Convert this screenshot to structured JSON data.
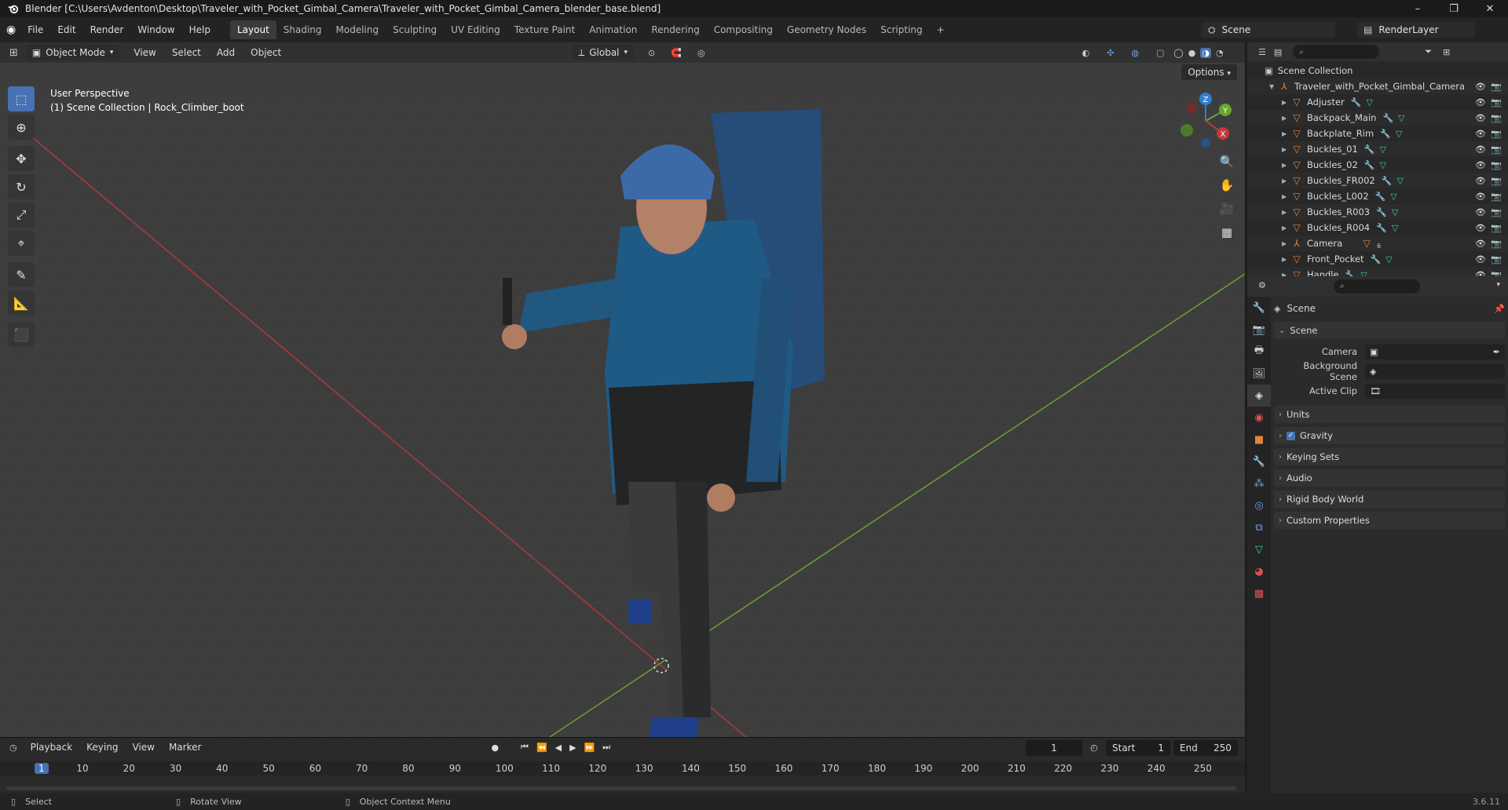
{
  "window": {
    "title": "Blender [C:\\Users\\Avdenton\\Desktop\\Traveler_with_Pocket_Gimbal_Camera\\Traveler_with_Pocket_Gimbal_Camera_blender_base.blend]",
    "controls": [
      "–",
      "❐",
      "✕"
    ]
  },
  "menu": [
    "File",
    "Edit",
    "Render",
    "Window",
    "Help"
  ],
  "workspaces": [
    "Layout",
    "Shading",
    "Modeling",
    "Sculpting",
    "UV Editing",
    "Texture Paint",
    "Animation",
    "Rendering",
    "Compositing",
    "Geometry Nodes",
    "Scripting",
    "+"
  ],
  "scene_name": "Scene",
  "view_layer": "RenderLayer",
  "viewport": {
    "mode": "Object Mode",
    "menus": [
      "View",
      "Select",
      "Add",
      "Object"
    ],
    "orientation": "Global",
    "options_label": "Options",
    "info_line1": "User Perspective",
    "info_line2": "(1) Scene Collection | Rock_Climber_boot",
    "axes": {
      "x": "X",
      "y": "Y",
      "z": "Z"
    }
  },
  "timeline": {
    "menus": [
      "Playback",
      "Keying",
      "View",
      "Marker"
    ],
    "current_frame": "1",
    "start_label": "Start",
    "start": "1",
    "end_label": "End",
    "end": "250",
    "ticks": [
      "1",
      "10",
      "20",
      "30",
      "40",
      "50",
      "60",
      "70",
      "80",
      "90",
      "100",
      "110",
      "120",
      "130",
      "140",
      "150",
      "160",
      "170",
      "180",
      "190",
      "200",
      "210",
      "220",
      "230",
      "240",
      "250"
    ]
  },
  "statusbar": {
    "select": "Select",
    "rotate": "Rotate View",
    "context": "Object Context Menu",
    "version": "3.6.11"
  },
  "outliner": {
    "root": "Scene Collection",
    "collection": "Traveler_with_Pocket_Gimbal_Camera",
    "items": [
      {
        "name": "Adjuster",
        "type": "mesh"
      },
      {
        "name": "Backpack_Main",
        "type": "mesh"
      },
      {
        "name": "Backplate_Rim",
        "type": "mesh"
      },
      {
        "name": "Buckles_01",
        "type": "mesh"
      },
      {
        "name": "Buckles_02",
        "type": "mesh"
      },
      {
        "name": "Buckles_FR002",
        "type": "mesh"
      },
      {
        "name": "Buckles_L002",
        "type": "mesh"
      },
      {
        "name": "Buckles_R003",
        "type": "mesh"
      },
      {
        "name": "Buckles_R004",
        "type": "mesh"
      },
      {
        "name": "Camera",
        "type": "armature",
        "count": "6"
      },
      {
        "name": "Front_Pocket",
        "type": "mesh"
      },
      {
        "name": "Handle",
        "type": "mesh"
      }
    ]
  },
  "properties": {
    "context_title": "Scene",
    "panel_scene": "Scene",
    "camera_label": "Camera",
    "bg_scene_label": "Background Scene",
    "active_clip_label": "Active Clip",
    "panels": [
      "Units",
      "Gravity",
      "Keying Sets",
      "Audio",
      "Rigid Body World",
      "Custom Properties"
    ],
    "gravity_checked": true
  },
  "colors": {
    "accent": "#4772b3",
    "x_axis": "#c0393b",
    "y_axis": "#6aa52a",
    "z_axis": "#2f7fd0"
  }
}
